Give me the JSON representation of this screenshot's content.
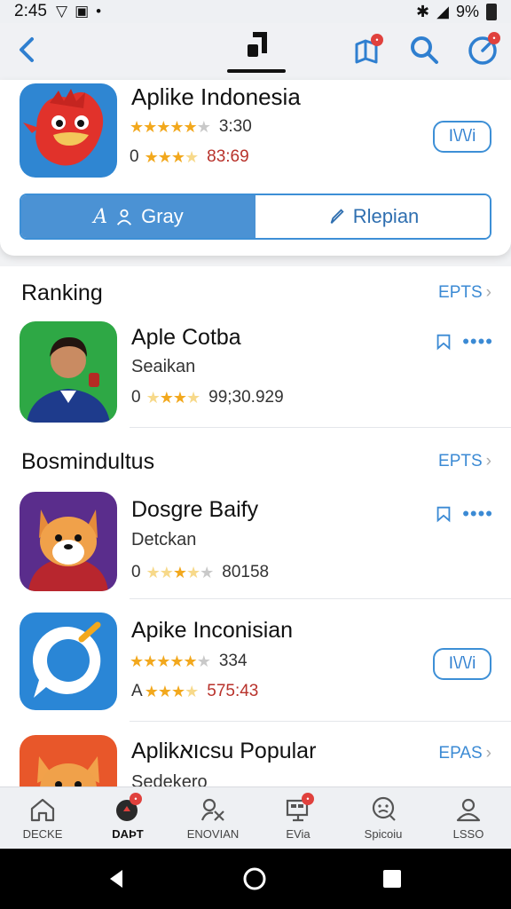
{
  "status": {
    "time": "2:45",
    "battery": "9%"
  },
  "featured": {
    "title": "Aplike Indonesia",
    "rating_value": "3:30",
    "secondary_prefix": "0",
    "secondary_value": "83:69",
    "action_label": "I\\/\\/i",
    "tabs": [
      {
        "label": "Gray",
        "glyph": "A"
      },
      {
        "label": "Rlepian"
      }
    ]
  },
  "sections": [
    {
      "title": "Ranking",
      "more_label": "EPTS"
    },
    {
      "title": "Bosmindultus",
      "more_label": "EPTS"
    }
  ],
  "apps": [
    {
      "name": "Aple Cotba",
      "subtitle": "Seaikan",
      "prefix": "0",
      "value": "99;30.929"
    },
    {
      "name": "Dosgre Baify",
      "subtitle": "Detckan",
      "prefix": "0",
      "value": "80158"
    },
    {
      "name": "Apike Inconisian",
      "rating_value": "334",
      "prefix": "A",
      "value": "575:43",
      "action_label": "I\\/\\/i"
    },
    {
      "name": "Aplikואcsu Popular",
      "subtitle": "Sedekero",
      "more_label": "EPAS"
    }
  ],
  "nav": [
    {
      "label": "DECKE",
      "icon": "home-icon"
    },
    {
      "label": "DAÞT",
      "icon": "apps-icon"
    },
    {
      "label": "ENOVIAN",
      "icon": "games-icon"
    },
    {
      "label": "EVia",
      "icon": "tv-icon"
    },
    {
      "label": "Spicoiu",
      "icon": "explore-icon"
    },
    {
      "label": "LSSO",
      "icon": "profile-icon"
    }
  ],
  "colors": {
    "accent": "#3b8ad4",
    "star": "#f2a81d",
    "badge": "#e0413d"
  }
}
